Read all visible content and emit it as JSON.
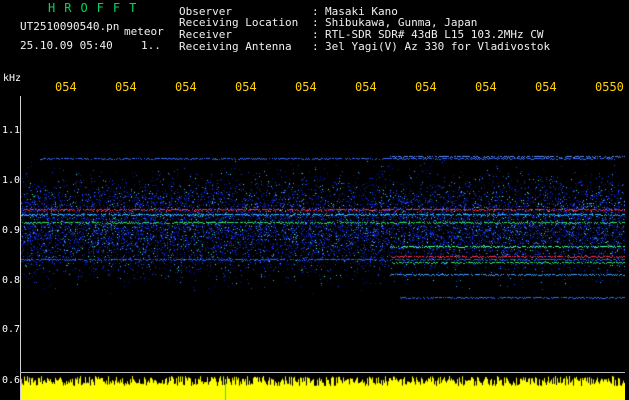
{
  "header": {
    "brand": "HROFFT",
    "filename": "UT2510090540.pn",
    "mode": "meteor",
    "datetime": "25.10.09 05:40",
    "marker": "1..",
    "info": [
      {
        "key": "Observer",
        "value": "Masaki Kano"
      },
      {
        "key": "Receiving Location",
        "value": "Shibukawa, Gunma, Japan"
      },
      {
        "key": "Receiver",
        "value": "RTL-SDR SDR# 43dB L15 103.2MHz CW"
      },
      {
        "key": "Receiving Antenna",
        "value": "3el Yagi(V) Az 330 for Vladivostok"
      }
    ]
  },
  "axes": {
    "y_unit": "kHz",
    "y_ticks": [
      "1.1",
      "1.0",
      "0.9",
      "0.8",
      "0.7",
      "0.6"
    ],
    "x_ticks": [
      "054",
      "054",
      "054",
      "054",
      "054",
      "054",
      "054",
      "054",
      "054",
      "0550"
    ]
  },
  "colors": {
    "background": "#000000",
    "brand": "#00d65a",
    "time_ticks": "#ffd200",
    "amplitude": "#ffff00"
  }
}
